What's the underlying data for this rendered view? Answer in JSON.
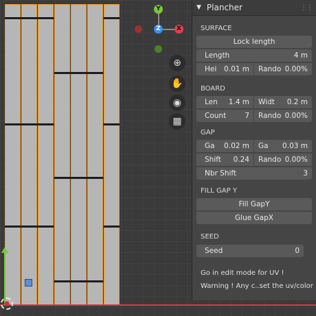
{
  "panel": {
    "title": "Plancher",
    "sections": {
      "surface": "SURFACE",
      "board": "BOARD",
      "gap": "GAP",
      "fill_gap_y": "FILL GAP Y",
      "seed": "SEED"
    },
    "surface": {
      "lock_length": "Lock length",
      "length_label": "Length",
      "length_value": "4 m",
      "height_label": "Hei",
      "height_value": "0.01 m",
      "random_label": "Rando",
      "random_value": "0.00%"
    },
    "board": {
      "length_label": "Len",
      "length_value": "1.4 m",
      "width_label": "Widt",
      "width_value": "0.2 m",
      "count_label": "Count",
      "count_value": "7",
      "random_label": "Rando",
      "random_value": "0.00%"
    },
    "gap": {
      "gap_x_label": "Ga",
      "gap_x_value": "0.02 m",
      "gap_y_label": "Ga",
      "gap_y_value": "0.03 m",
      "shift_label": "Shift",
      "shift_value": "0.24",
      "random_label": "Rando",
      "random_value": "0.00%",
      "nbr_shift_label": "Nbr Shift",
      "nbr_shift_value": "3"
    },
    "fill": {
      "fill_gap_y": "Fill GapY",
      "glue_gap_x": "Glue GapX"
    },
    "seed": {
      "label": "Seed",
      "value": "0"
    },
    "notes": {
      "uv": "Go in edit mode for UV !",
      "warning": "Warning ! Any c..set the uv/color !"
    }
  },
  "gizmo": {
    "y": "Y",
    "z": "Z",
    "x": "X"
  },
  "colors": {
    "selection": "#f29a1f",
    "x_axis": "#cf3f49",
    "y_axis": "#7cc63a",
    "z_axis": "#3b8ee6"
  }
}
